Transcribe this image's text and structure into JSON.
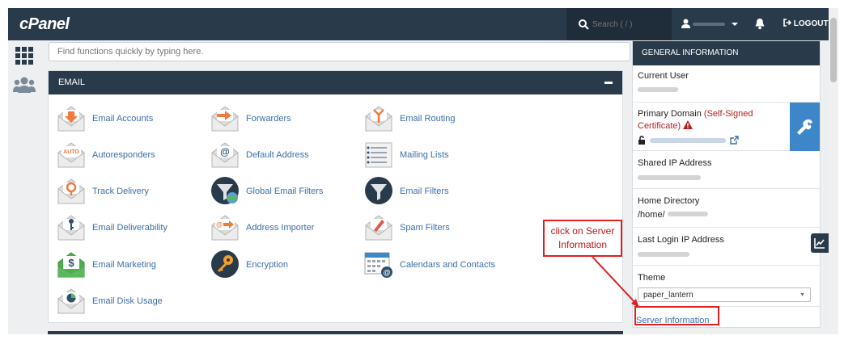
{
  "header": {
    "logo": "cPanel",
    "search_placeholder": "Search ( / )",
    "logout_label": "LOGOUT"
  },
  "find": {
    "placeholder": "Find functions quickly by typing here."
  },
  "email_section": {
    "title": "EMAIL",
    "items": [
      {
        "label": "Email Accounts",
        "icon": "email-accounts-icon"
      },
      {
        "label": "Forwarders",
        "icon": "forwarders-icon"
      },
      {
        "label": "Email Routing",
        "icon": "email-routing-icon"
      },
      {
        "label": "Autoresponders",
        "icon": "autoresponders-icon"
      },
      {
        "label": "Default Address",
        "icon": "default-address-icon"
      },
      {
        "label": "Mailing Lists",
        "icon": "mailing-lists-icon"
      },
      {
        "label": "Track Delivery",
        "icon": "track-delivery-icon"
      },
      {
        "label": "Global Email Filters",
        "icon": "global-filters-icon"
      },
      {
        "label": "Email Filters",
        "icon": "email-filters-icon"
      },
      {
        "label": "Email Deliverability",
        "icon": "email-deliverability-icon"
      },
      {
        "label": "Address Importer",
        "icon": "address-importer-icon"
      },
      {
        "label": "Spam Filters",
        "icon": "spam-filters-icon"
      },
      {
        "label": "Email Marketing",
        "icon": "email-marketing-icon"
      },
      {
        "label": "Encryption",
        "icon": "encryption-icon"
      },
      {
        "label": "Calendars and Contacts",
        "icon": "calendars-icon"
      },
      {
        "label": "Email Disk Usage",
        "icon": "email-disk-usage-icon"
      }
    ]
  },
  "general_info": {
    "title": "GENERAL INFORMATION",
    "current_user_label": "Current User",
    "primary_domain_label": "Primary Domain",
    "self_signed": "(Self-Signed Certificate)",
    "shared_ip_label": "Shared IP Address",
    "home_dir_label": "Home Directory",
    "home_dir_prefix": "/home/",
    "last_login_label": "Last Login IP Address",
    "theme_label": "Theme",
    "theme_value": "paper_lantern",
    "server_info_link": "Server Information"
  },
  "annotation": {
    "callout_line1": "click on Server",
    "callout_line2": "Information"
  },
  "colors": {
    "header_bg": "#293a4a",
    "link": "#3a6fa8",
    "annotation": "#e02020",
    "wrench_tile": "#3d87c9"
  }
}
